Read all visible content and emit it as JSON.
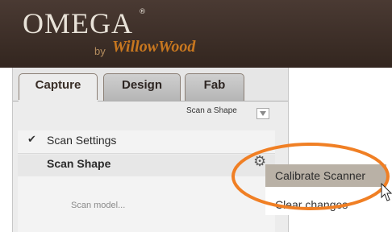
{
  "logo": {
    "main": "OMEGA",
    "registered": "®",
    "by": "by",
    "sub": "WillowWood"
  },
  "tabs": [
    {
      "label": "Capture",
      "active": true
    },
    {
      "label": "Design",
      "active": false
    },
    {
      "label": "Fab",
      "active": false
    }
  ],
  "toolbar": {
    "scan_a_shape": "Scan a Shape"
  },
  "sections": {
    "scan_settings": "Scan Settings",
    "scan_shape": "Scan Shape",
    "scan_model": "Scan model..."
  },
  "context_menu": {
    "items": [
      {
        "label": "Calibrate Scanner",
        "highlighted": true
      },
      {
        "label": "Clear changes",
        "highlighted": false
      }
    ]
  },
  "colors": {
    "header": "#3a2c25",
    "brand_orange": "#c8771f",
    "highlight_ring": "#f07f24",
    "menu_highlight": "#b9b1a6"
  }
}
